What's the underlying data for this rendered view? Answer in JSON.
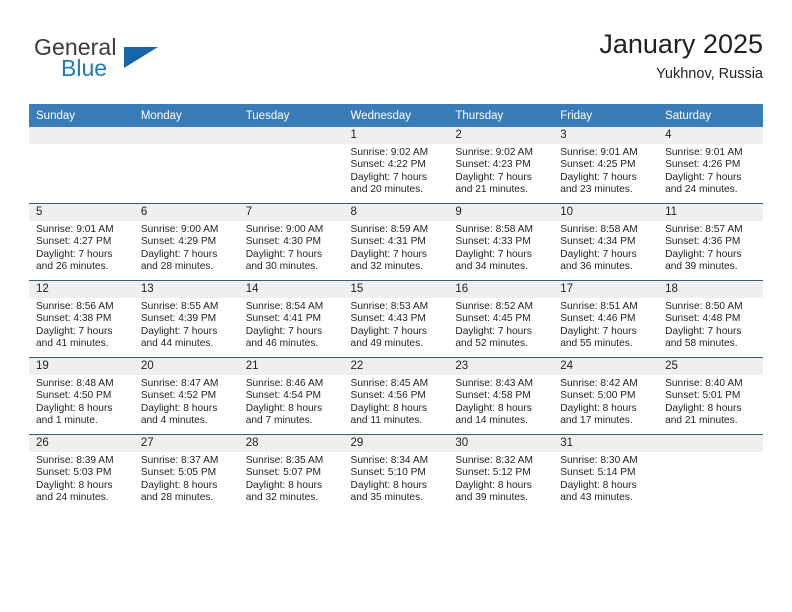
{
  "brand": {
    "name_top": "General",
    "name_bottom": "Blue",
    "triangle_icon": "triangle-icon",
    "color_top": "#3b3b3b",
    "color_bottom": "#1e7ac4"
  },
  "header": {
    "title": "January 2025",
    "subtitle": "Yukhnov, Russia"
  },
  "theme": {
    "header_bg": "#3a7cb8",
    "header_text": "#ffffff",
    "daynum_band_bg": "#efefef",
    "row_separator": "#2e5f87",
    "text": "#231f20"
  },
  "weekday_headers": [
    "Sunday",
    "Monday",
    "Tuesday",
    "Wednesday",
    "Thursday",
    "Friday",
    "Saturday"
  ],
  "weeks": [
    [
      {
        "day": "",
        "empty": true,
        "sunrise": "",
        "sunset": "",
        "daylight_1": "",
        "daylight_2": ""
      },
      {
        "day": "",
        "empty": true,
        "sunrise": "",
        "sunset": "",
        "daylight_1": "",
        "daylight_2": ""
      },
      {
        "day": "",
        "empty": true,
        "sunrise": "",
        "sunset": "",
        "daylight_1": "",
        "daylight_2": ""
      },
      {
        "day": "1",
        "empty": false,
        "sunrise": "Sunrise: 9:02 AM",
        "sunset": "Sunset: 4:22 PM",
        "daylight_1": "Daylight: 7 hours",
        "daylight_2": "and 20 minutes."
      },
      {
        "day": "2",
        "empty": false,
        "sunrise": "Sunrise: 9:02 AM",
        "sunset": "Sunset: 4:23 PM",
        "daylight_1": "Daylight: 7 hours",
        "daylight_2": "and 21 minutes."
      },
      {
        "day": "3",
        "empty": false,
        "sunrise": "Sunrise: 9:01 AM",
        "sunset": "Sunset: 4:25 PM",
        "daylight_1": "Daylight: 7 hours",
        "daylight_2": "and 23 minutes."
      },
      {
        "day": "4",
        "empty": false,
        "sunrise": "Sunrise: 9:01 AM",
        "sunset": "Sunset: 4:26 PM",
        "daylight_1": "Daylight: 7 hours",
        "daylight_2": "and 24 minutes."
      }
    ],
    [
      {
        "day": "5",
        "empty": false,
        "sunrise": "Sunrise: 9:01 AM",
        "sunset": "Sunset: 4:27 PM",
        "daylight_1": "Daylight: 7 hours",
        "daylight_2": "and 26 minutes."
      },
      {
        "day": "6",
        "empty": false,
        "sunrise": "Sunrise: 9:00 AM",
        "sunset": "Sunset: 4:29 PM",
        "daylight_1": "Daylight: 7 hours",
        "daylight_2": "and 28 minutes."
      },
      {
        "day": "7",
        "empty": false,
        "sunrise": "Sunrise: 9:00 AM",
        "sunset": "Sunset: 4:30 PM",
        "daylight_1": "Daylight: 7 hours",
        "daylight_2": "and 30 minutes."
      },
      {
        "day": "8",
        "empty": false,
        "sunrise": "Sunrise: 8:59 AM",
        "sunset": "Sunset: 4:31 PM",
        "daylight_1": "Daylight: 7 hours",
        "daylight_2": "and 32 minutes."
      },
      {
        "day": "9",
        "empty": false,
        "sunrise": "Sunrise: 8:58 AM",
        "sunset": "Sunset: 4:33 PM",
        "daylight_1": "Daylight: 7 hours",
        "daylight_2": "and 34 minutes."
      },
      {
        "day": "10",
        "empty": false,
        "sunrise": "Sunrise: 8:58 AM",
        "sunset": "Sunset: 4:34 PM",
        "daylight_1": "Daylight: 7 hours",
        "daylight_2": "and 36 minutes."
      },
      {
        "day": "11",
        "empty": false,
        "sunrise": "Sunrise: 8:57 AM",
        "sunset": "Sunset: 4:36 PM",
        "daylight_1": "Daylight: 7 hours",
        "daylight_2": "and 39 minutes."
      }
    ],
    [
      {
        "day": "12",
        "empty": false,
        "sunrise": "Sunrise: 8:56 AM",
        "sunset": "Sunset: 4:38 PM",
        "daylight_1": "Daylight: 7 hours",
        "daylight_2": "and 41 minutes."
      },
      {
        "day": "13",
        "empty": false,
        "sunrise": "Sunrise: 8:55 AM",
        "sunset": "Sunset: 4:39 PM",
        "daylight_1": "Daylight: 7 hours",
        "daylight_2": "and 44 minutes."
      },
      {
        "day": "14",
        "empty": false,
        "sunrise": "Sunrise: 8:54 AM",
        "sunset": "Sunset: 4:41 PM",
        "daylight_1": "Daylight: 7 hours",
        "daylight_2": "and 46 minutes."
      },
      {
        "day": "15",
        "empty": false,
        "sunrise": "Sunrise: 8:53 AM",
        "sunset": "Sunset: 4:43 PM",
        "daylight_1": "Daylight: 7 hours",
        "daylight_2": "and 49 minutes."
      },
      {
        "day": "16",
        "empty": false,
        "sunrise": "Sunrise: 8:52 AM",
        "sunset": "Sunset: 4:45 PM",
        "daylight_1": "Daylight: 7 hours",
        "daylight_2": "and 52 minutes."
      },
      {
        "day": "17",
        "empty": false,
        "sunrise": "Sunrise: 8:51 AM",
        "sunset": "Sunset: 4:46 PM",
        "daylight_1": "Daylight: 7 hours",
        "daylight_2": "and 55 minutes."
      },
      {
        "day": "18",
        "empty": false,
        "sunrise": "Sunrise: 8:50 AM",
        "sunset": "Sunset: 4:48 PM",
        "daylight_1": "Daylight: 7 hours",
        "daylight_2": "and 58 minutes."
      }
    ],
    [
      {
        "day": "19",
        "empty": false,
        "sunrise": "Sunrise: 8:48 AM",
        "sunset": "Sunset: 4:50 PM",
        "daylight_1": "Daylight: 8 hours",
        "daylight_2": "and 1 minute."
      },
      {
        "day": "20",
        "empty": false,
        "sunrise": "Sunrise: 8:47 AM",
        "sunset": "Sunset: 4:52 PM",
        "daylight_1": "Daylight: 8 hours",
        "daylight_2": "and 4 minutes."
      },
      {
        "day": "21",
        "empty": false,
        "sunrise": "Sunrise: 8:46 AM",
        "sunset": "Sunset: 4:54 PM",
        "daylight_1": "Daylight: 8 hours",
        "daylight_2": "and 7 minutes."
      },
      {
        "day": "22",
        "empty": false,
        "sunrise": "Sunrise: 8:45 AM",
        "sunset": "Sunset: 4:56 PM",
        "daylight_1": "Daylight: 8 hours",
        "daylight_2": "and 11 minutes."
      },
      {
        "day": "23",
        "empty": false,
        "sunrise": "Sunrise: 8:43 AM",
        "sunset": "Sunset: 4:58 PM",
        "daylight_1": "Daylight: 8 hours",
        "daylight_2": "and 14 minutes."
      },
      {
        "day": "24",
        "empty": false,
        "sunrise": "Sunrise: 8:42 AM",
        "sunset": "Sunset: 5:00 PM",
        "daylight_1": "Daylight: 8 hours",
        "daylight_2": "and 17 minutes."
      },
      {
        "day": "25",
        "empty": false,
        "sunrise": "Sunrise: 8:40 AM",
        "sunset": "Sunset: 5:01 PM",
        "daylight_1": "Daylight: 8 hours",
        "daylight_2": "and 21 minutes."
      }
    ],
    [
      {
        "day": "26",
        "empty": false,
        "sunrise": "Sunrise: 8:39 AM",
        "sunset": "Sunset: 5:03 PM",
        "daylight_1": "Daylight: 8 hours",
        "daylight_2": "and 24 minutes."
      },
      {
        "day": "27",
        "empty": false,
        "sunrise": "Sunrise: 8:37 AM",
        "sunset": "Sunset: 5:05 PM",
        "daylight_1": "Daylight: 8 hours",
        "daylight_2": "and 28 minutes."
      },
      {
        "day": "28",
        "empty": false,
        "sunrise": "Sunrise: 8:35 AM",
        "sunset": "Sunset: 5:07 PM",
        "daylight_1": "Daylight: 8 hours",
        "daylight_2": "and 32 minutes."
      },
      {
        "day": "29",
        "empty": false,
        "sunrise": "Sunrise: 8:34 AM",
        "sunset": "Sunset: 5:10 PM",
        "daylight_1": "Daylight: 8 hours",
        "daylight_2": "and 35 minutes."
      },
      {
        "day": "30",
        "empty": false,
        "sunrise": "Sunrise: 8:32 AM",
        "sunset": "Sunset: 5:12 PM",
        "daylight_1": "Daylight: 8 hours",
        "daylight_2": "and 39 minutes."
      },
      {
        "day": "31",
        "empty": false,
        "sunrise": "Sunrise: 8:30 AM",
        "sunset": "Sunset: 5:14 PM",
        "daylight_1": "Daylight: 8 hours",
        "daylight_2": "and 43 minutes."
      },
      {
        "day": "",
        "empty": true,
        "sunrise": "",
        "sunset": "",
        "daylight_1": "",
        "daylight_2": ""
      }
    ]
  ]
}
